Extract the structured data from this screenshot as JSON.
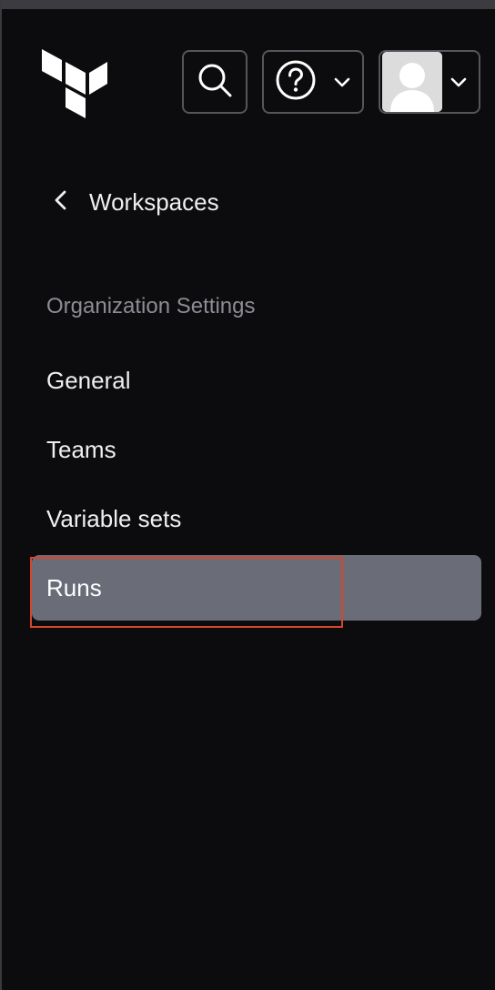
{
  "header": {
    "logo_icon": "terraform-logo-icon",
    "search_icon": "search-icon",
    "help_icon": "help-circle-icon",
    "user_icon": "user-avatar-icon",
    "chevron_icon": "chevron-down-icon"
  },
  "back_link": {
    "icon": "chevron-left-icon",
    "label": "Workspaces"
  },
  "nav": {
    "section_title": "Organization Settings",
    "items": [
      {
        "label": "General",
        "active": false
      },
      {
        "label": "Teams",
        "active": false
      },
      {
        "label": "Variable sets",
        "active": false
      },
      {
        "label": "Runs",
        "active": true
      }
    ]
  },
  "colors": {
    "background": "#0c0c0e",
    "active_item": "#6a6d78",
    "section_title": "#8c8d94",
    "highlight": "#d8442c",
    "text": "#efeff1"
  }
}
